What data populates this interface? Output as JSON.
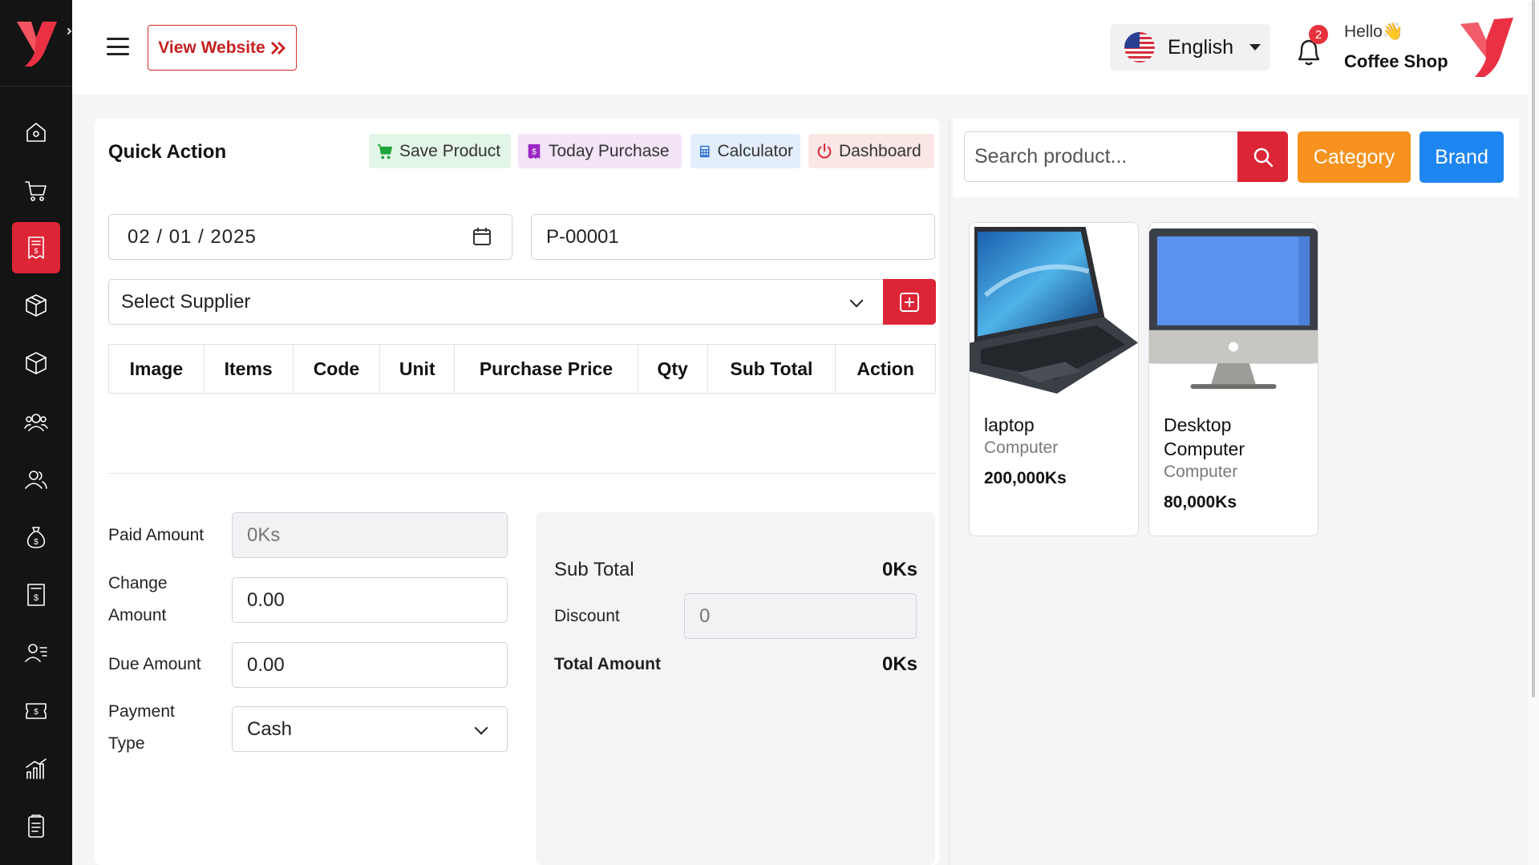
{
  "header": {
    "view_website": "View Website",
    "language": "English",
    "notification_count": "2",
    "greeting": "Hello👋",
    "user_name": "Coffee Shop"
  },
  "sidebar": {
    "items": [
      {
        "icon": "home-icon"
      },
      {
        "icon": "cart-icon"
      },
      {
        "icon": "receipt-icon",
        "active": true
      },
      {
        "icon": "box-icon"
      },
      {
        "icon": "package-icon"
      },
      {
        "icon": "users-icon"
      },
      {
        "icon": "user-group-icon"
      },
      {
        "icon": "money-bag-icon"
      },
      {
        "icon": "invoice-icon"
      },
      {
        "icon": "user-list-icon"
      },
      {
        "icon": "ticket-icon"
      },
      {
        "icon": "chart-icon"
      },
      {
        "icon": "report-icon"
      }
    ]
  },
  "quick_action": {
    "title": "Quick Action",
    "save_product": "Save Product",
    "today_purchase": "Today Purchase",
    "calculator": "Calculator",
    "dashboard": "Dashboard"
  },
  "form": {
    "date": "02 / 01 / 2025",
    "reference": "P-00001",
    "supplier_placeholder": "Select Supplier"
  },
  "table": {
    "columns": [
      "Image",
      "Items",
      "Code",
      "Unit",
      "Purchase Price",
      "Qty",
      "Sub Total",
      "Action"
    ]
  },
  "payment": {
    "paid_label": "Paid Amount",
    "paid_placeholder": "0Ks",
    "change_label_1": "Change",
    "change_label_2": "Amount",
    "change_value": "0.00",
    "due_label": "Due Amount",
    "due_value": "0.00",
    "type_label_1": "Payment",
    "type_label_2": "Type",
    "type_value": "Cash"
  },
  "summary": {
    "sub_total_label": "Sub Total",
    "sub_total_value": "0Ks",
    "discount_label": "Discount",
    "discount_placeholder": "0",
    "total_label": "Total Amount",
    "total_value": "0Ks"
  },
  "search": {
    "placeholder": "Search product...",
    "category": "Category",
    "brand": "Brand"
  },
  "products": [
    {
      "name": "laptop",
      "category": "Computer",
      "price": "200,000Ks"
    },
    {
      "name_line1": "Desktop",
      "name_line2": "Computer",
      "category": "Computer",
      "price": "80,000Ks"
    }
  ],
  "colors": {
    "brand_red": "#dc2535",
    "orange": "#f7921e",
    "blue": "#1e86f0",
    "sidebar": "#141414"
  }
}
